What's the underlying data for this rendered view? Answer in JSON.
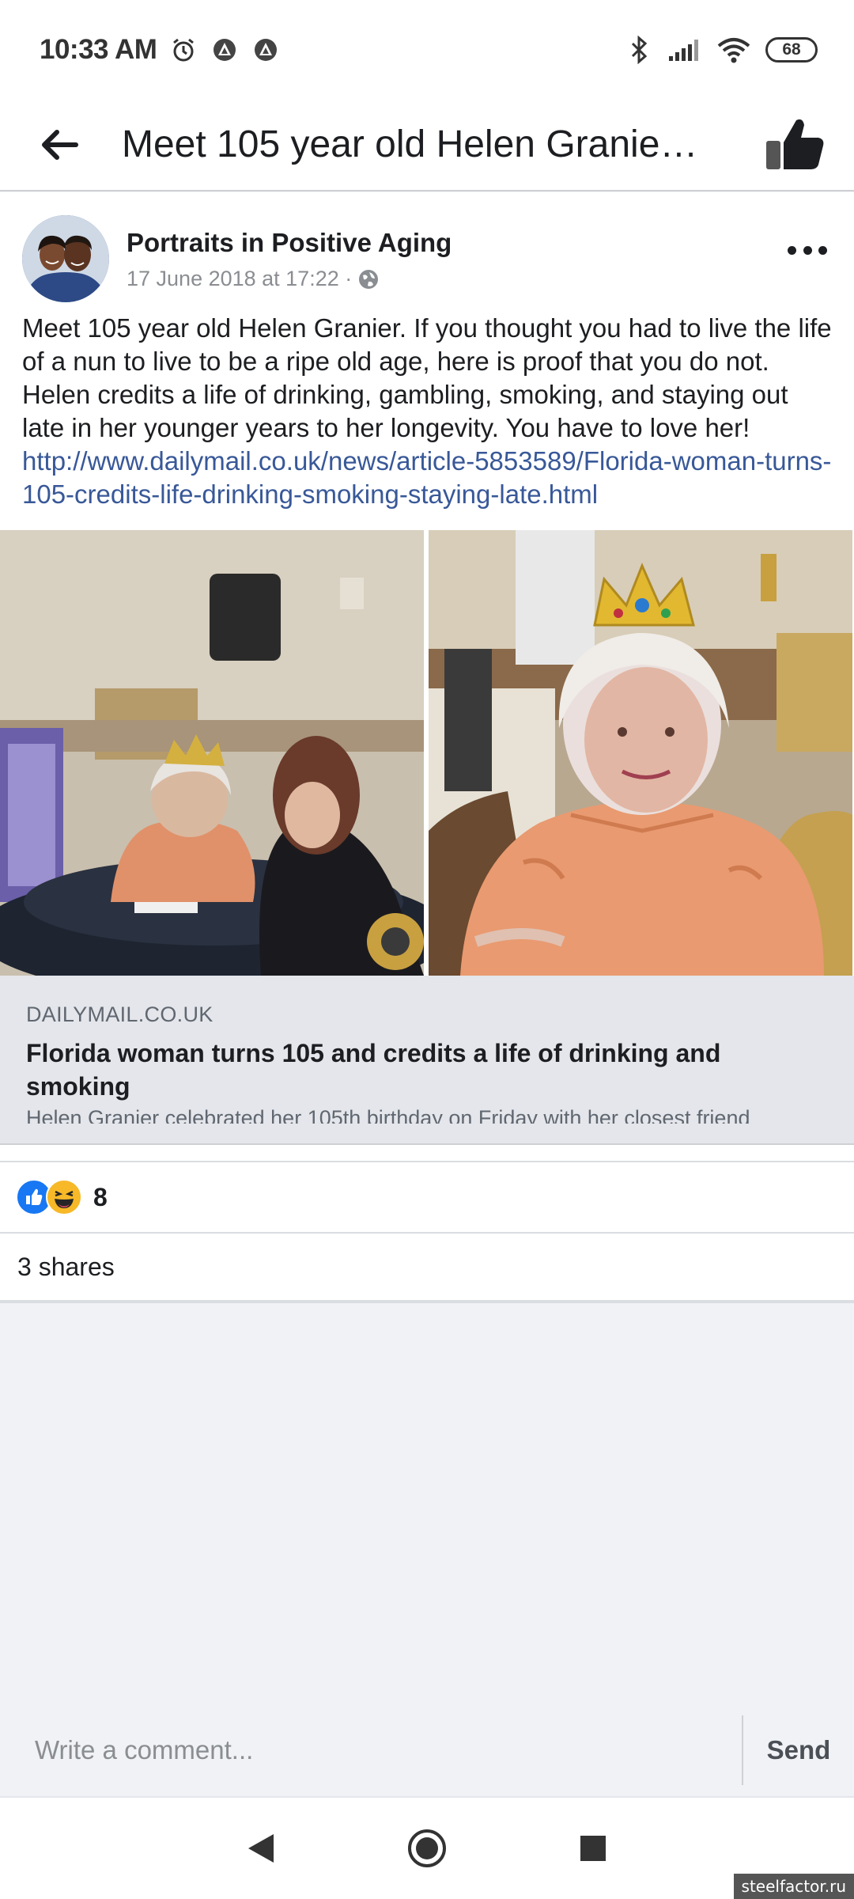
{
  "status_bar": {
    "time": "10:33 AM",
    "battery": "68",
    "icons": [
      "alarm-icon",
      "app-notification-icon",
      "app-notification-icon",
      "bluetooth-icon",
      "signal-icon",
      "wifi-icon"
    ]
  },
  "app_bar": {
    "title": "Meet 105 year old Helen Granie…"
  },
  "post": {
    "author": "Portraits in Positive Aging",
    "timestamp": "17 June 2018 at 17:22 ·",
    "text": "Meet 105 year old Helen Granier. If you thought you had to live the life of a nun to live to be a ripe old age, here is proof that you do not. Helen credits a life of drinking, gambling, smoking, and staying out late in her younger years to her longevity. You have to love her!",
    "link": "http://www.dailymail.co.uk/news/article-5853589/Florida-woman-turns-105-credits-life-drinking-smoking-staying-late.html",
    "link_card": {
      "domain": "DAILYMAIL.CO.UK",
      "title": "Florida woman turns 105 and credits a life of drinking and smoking",
      "description": "Helen Granier celebrated her 105th birthday on Friday with her closest friend"
    },
    "reaction_count": "8",
    "shares": "3 shares"
  },
  "comment_bar": {
    "placeholder": "Write a comment...",
    "send_label": "Send"
  },
  "watermark": "steelfactor.ru",
  "colors": {
    "link": "#385898",
    "like_blue": "#1877f2",
    "haha_yellow": "#f7b928"
  }
}
